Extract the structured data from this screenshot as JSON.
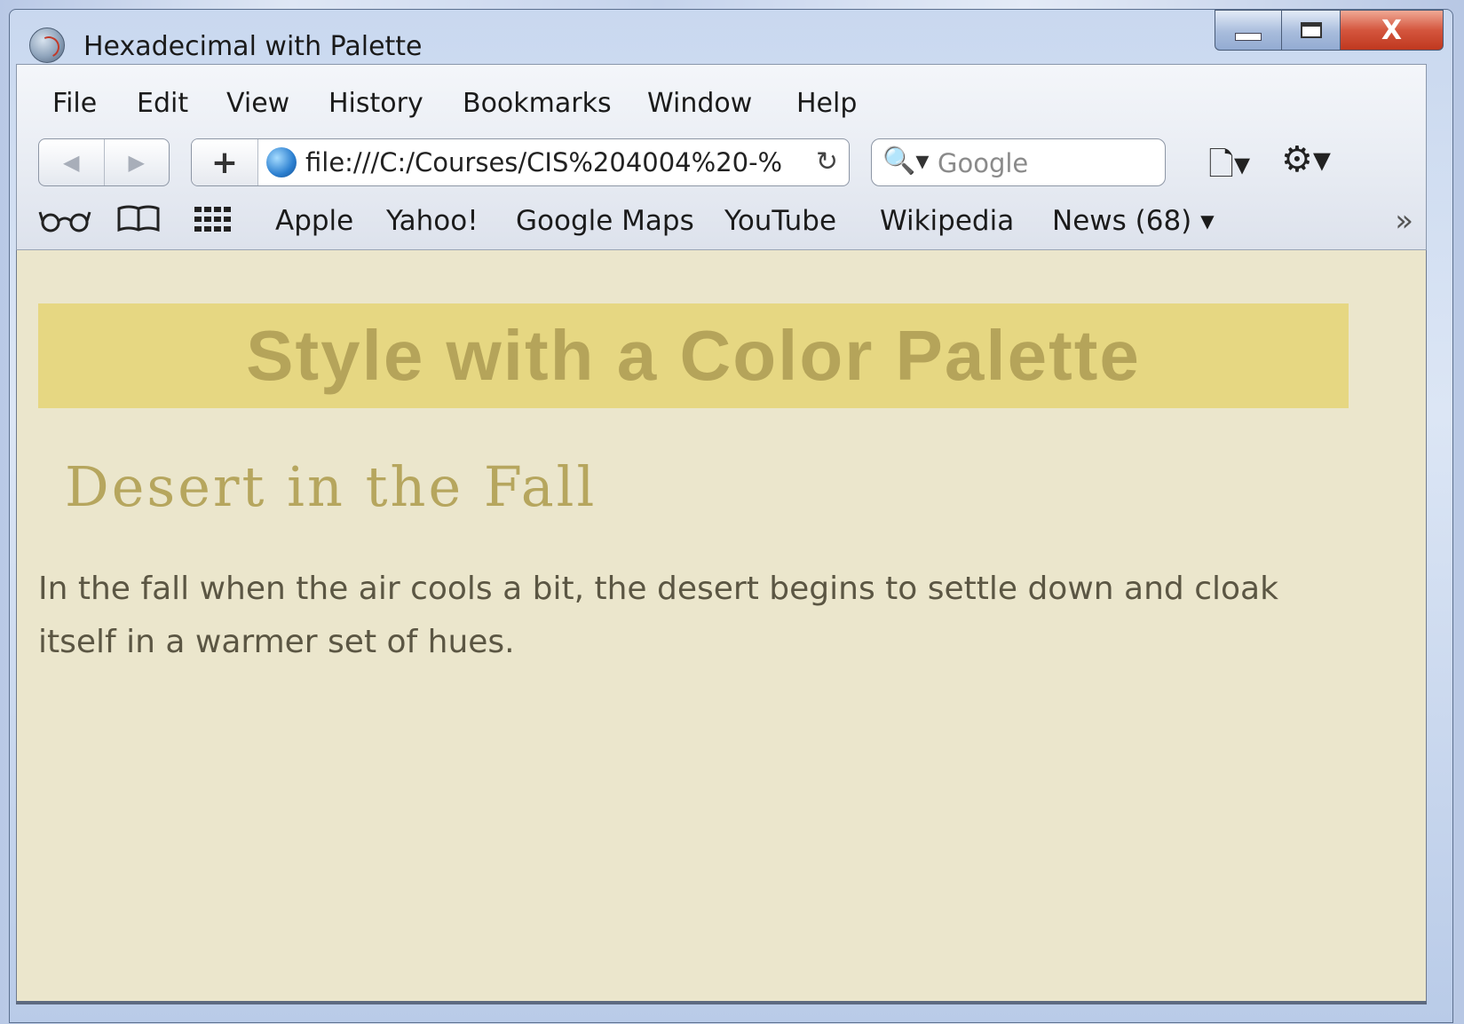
{
  "window": {
    "title": "Hexadecimal with Palette",
    "controls": {
      "close": "X"
    }
  },
  "menubar": [
    "File",
    "Edit",
    "View",
    "History",
    "Bookmarks",
    "Window",
    "Help"
  ],
  "toolbar": {
    "back_glyph": "◀",
    "forward_glyph": "▶",
    "add_glyph": "+",
    "url": "file:///C:/Courses/CIS%204004%20-%",
    "reload_glyph": "↻",
    "search_placeholder": "Google",
    "search_glyph": "🔍▾",
    "page_menu_glyph": "🗋▾",
    "gear_menu_glyph": "⚙▾"
  },
  "bookmarks": {
    "icons": [
      "reading-glasses-icon",
      "book-icon",
      "grid-icon"
    ],
    "items": [
      "Apple",
      "Yahoo!",
      "Google Maps",
      "YouTube",
      "Wikipedia",
      "News (68) ▾"
    ],
    "more_glyph": "»"
  },
  "page": {
    "banner": "Style with a Color Palette",
    "subheading": "Desert in the Fall",
    "paragraph": "In the fall when the air cools a bit, the desert begins to settle down and cloak itself in a warmer set of hues."
  },
  "colors": {
    "page_background": "#ebe6cc",
    "banner_background": "#e6d782",
    "banner_text": "#b5a45a",
    "subheading_text": "#b6a65e",
    "paragraph_text": "#5b5643"
  }
}
